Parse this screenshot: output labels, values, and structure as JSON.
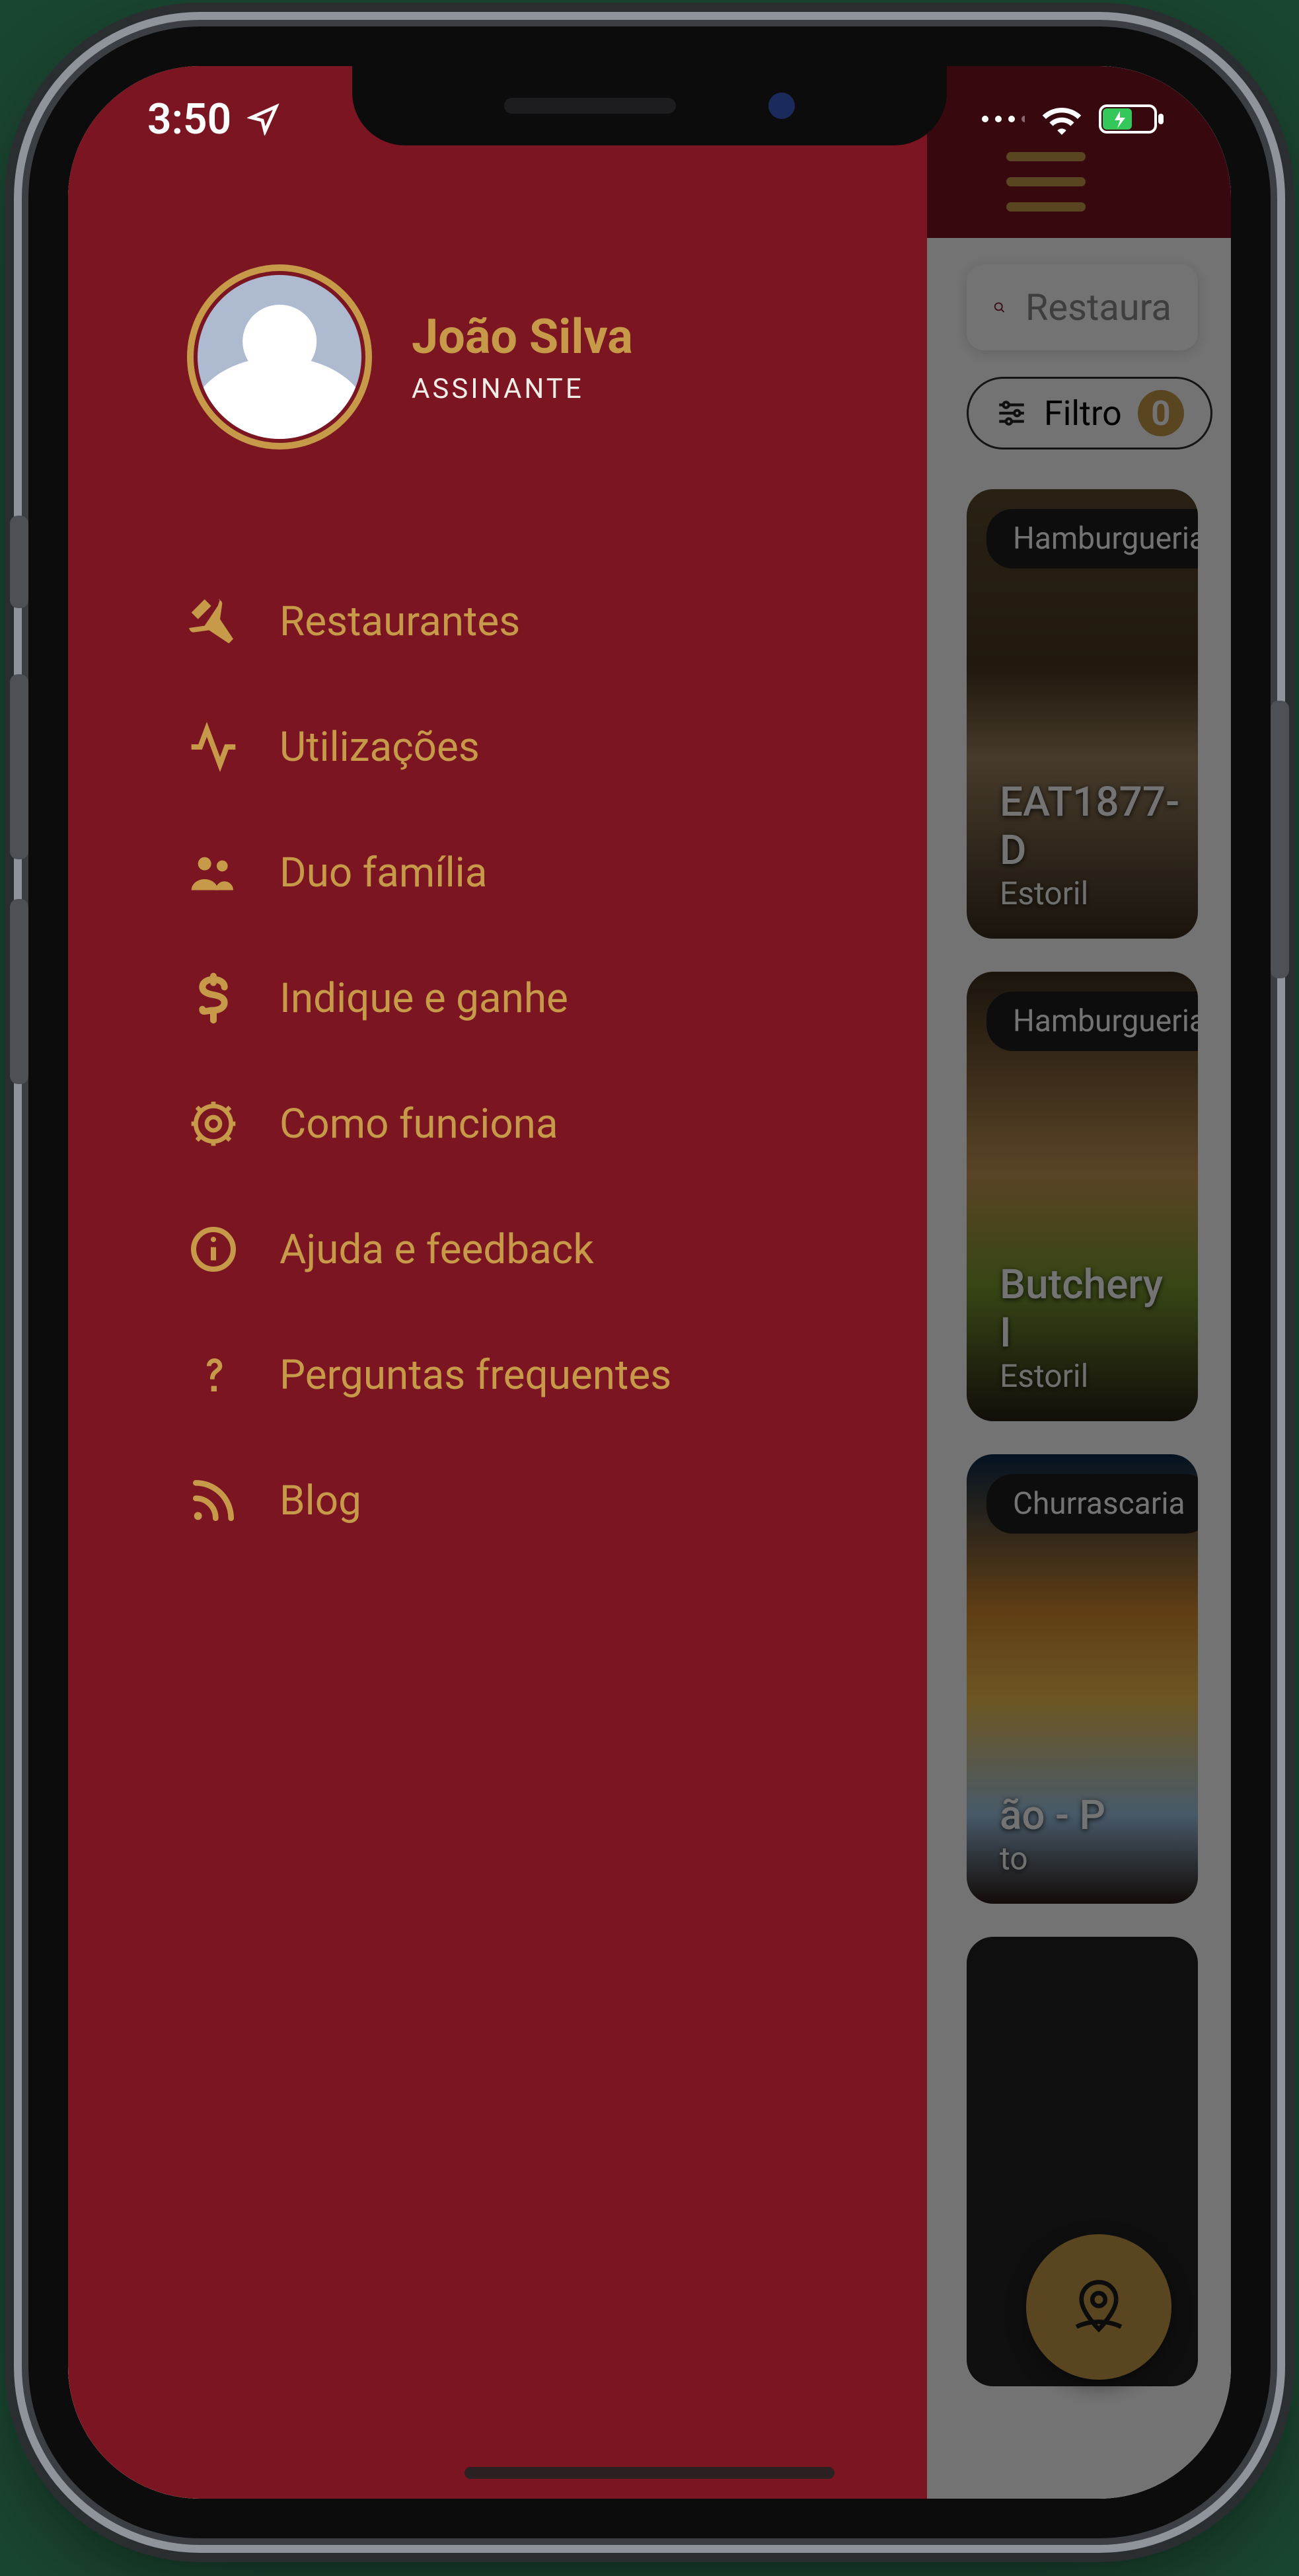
{
  "status_bar": {
    "time": "3:50"
  },
  "drawer": {
    "user_name": "João Silva",
    "user_role": "ASSINANTE",
    "items": [
      {
        "label": "Restaurantes"
      },
      {
        "label": "Utilizações"
      },
      {
        "label": "Duo família"
      },
      {
        "label": "Indique e ganhe"
      },
      {
        "label": "Como funciona"
      },
      {
        "label": "Ajuda e feedback"
      },
      {
        "label": "Perguntas frequentes"
      },
      {
        "label": "Blog"
      }
    ]
  },
  "main": {
    "search_placeholder": "Restaura",
    "filter_label": "Filtro",
    "filter_count": "0",
    "cards": [
      {
        "tag": "Hamburgueria",
        "title": "EAT1877- D",
        "subtitle": "Estoril"
      },
      {
        "tag": "Hamburgueria",
        "title": "Butchery I",
        "subtitle": "Estoril"
      },
      {
        "tag": "Churrascaria",
        "title": "ão - P",
        "subtitle": "to"
      }
    ]
  }
}
